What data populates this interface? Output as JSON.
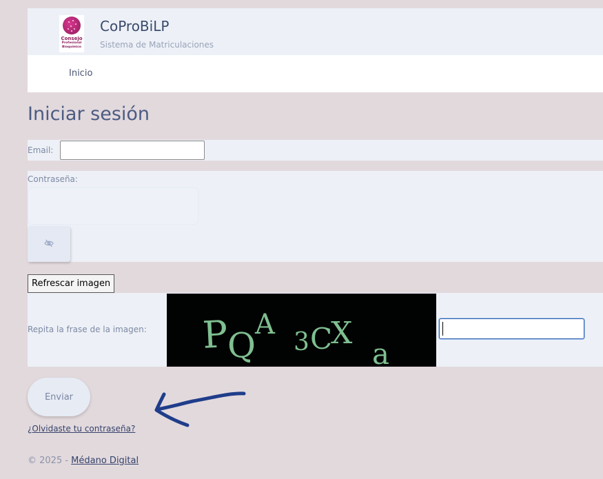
{
  "header": {
    "logo_text_main": "Consejo",
    "logo_text_sub1": "Profesional",
    "logo_text_sub2": "Bioquímico",
    "title": "CoProBiLP",
    "subtitle": "Sistema de Matriculaciones"
  },
  "nav": {
    "items": [
      {
        "label": "Inicio"
      }
    ]
  },
  "login": {
    "heading": "Iniciar sesión",
    "email_label": "Email:",
    "email_value": "",
    "password_label": "Contraseña:",
    "password_value": "",
    "toggle_password_icon": "eye-slash-icon",
    "refresh_button": "Refrescar imagen",
    "captcha_label": "Repita la frase de la imagen:",
    "captcha_text": "PQA3CXa",
    "captcha_value": "",
    "submit_button": "Enviar",
    "forgot_password_link": "¿Olvidaste tu contraseña?"
  },
  "annotation": {
    "icon": "hand-drawn-arrow-icon",
    "color": "#1f3d8a"
  },
  "footer": {
    "copyright": "© 2025 - ",
    "company_link": "Médano Digital"
  },
  "colors": {
    "page_background": "#e2d9dd",
    "panel_background": "#edf1f7",
    "heading": "#4b5b82",
    "brand": "#8e1c5c"
  }
}
